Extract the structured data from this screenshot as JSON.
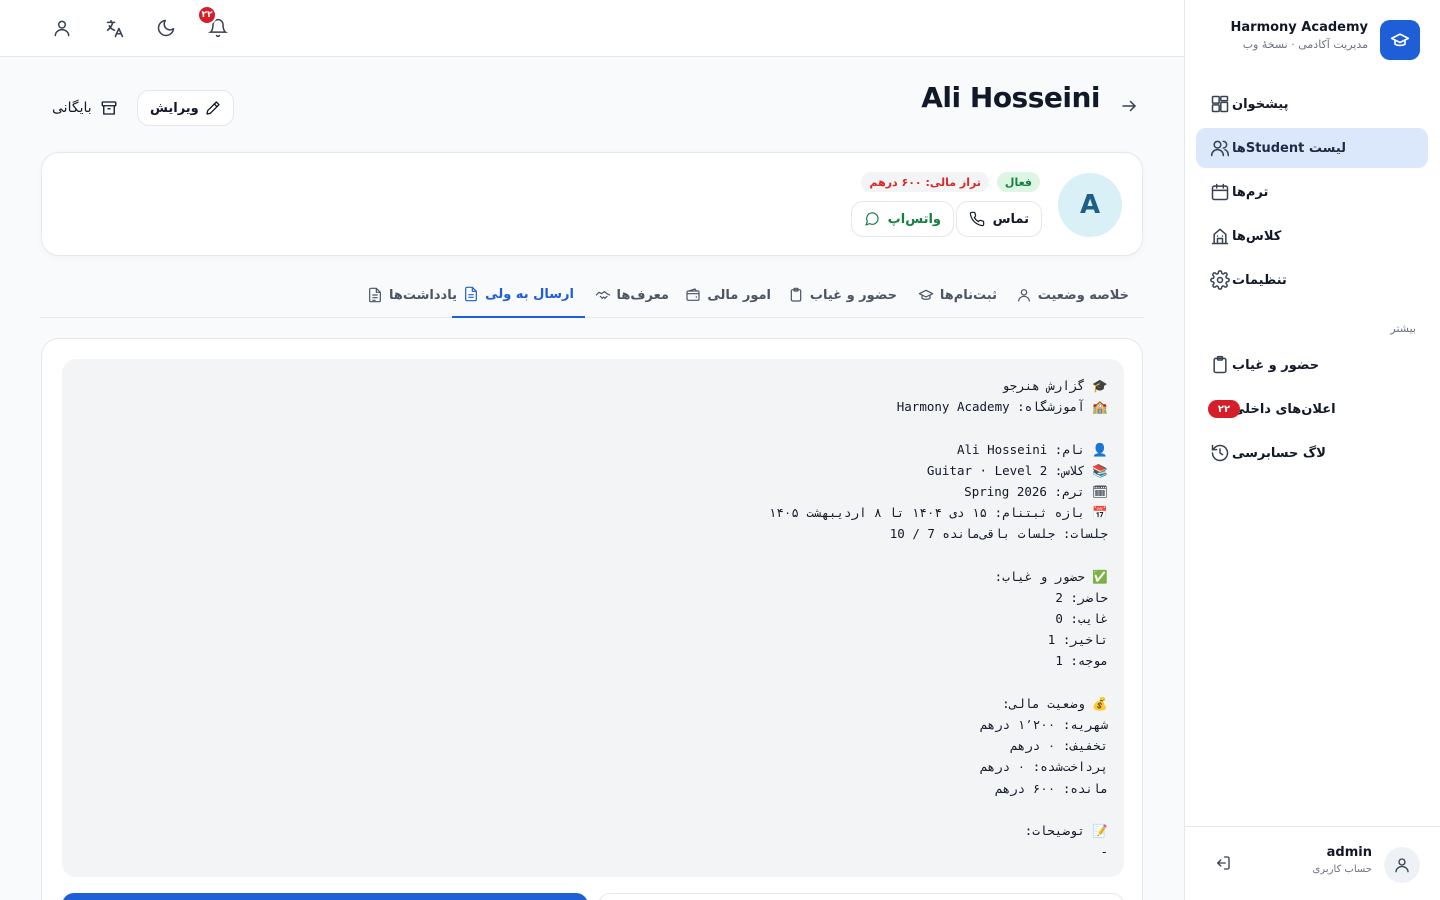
{
  "brand": {
    "title": "Harmony Academy",
    "subtitle": "مدیریت آکادمی · نسخهٔ وب"
  },
  "sidebar": {
    "items": [
      {
        "label": "پیشخوان",
        "icon": "dashboard-icon",
        "active": false
      },
      {
        "label": "لیست Studentها",
        "icon": "users-icon",
        "active": true
      },
      {
        "label": "ترم‌ها",
        "icon": "calendar-icon",
        "active": false
      },
      {
        "label": "کلاس‌ها",
        "icon": "building-icon",
        "active": false
      },
      {
        "label": "تنظیمات",
        "icon": "gear-icon",
        "active": false
      }
    ],
    "more_title": "بیشتر",
    "more_items": [
      {
        "label": "حضور و غیاب",
        "icon": "clipboard-icon"
      },
      {
        "label": "اعلان‌های داخلی",
        "icon": "bell-icon",
        "badge": "۲۲"
      },
      {
        "label": "لاگ حسابرسی",
        "icon": "history-icon"
      }
    ]
  },
  "user": {
    "name": "admin",
    "role": "حساب کاربری"
  },
  "topbar": {
    "notification_count": "۲۲"
  },
  "page": {
    "title": "Ali Hosseini",
    "edit_label": "ویرایش",
    "archive_label": "بایگانی"
  },
  "profile": {
    "avatar_letter": "A",
    "status": "فعال",
    "balance": "تراز مالی: ۶۰۰ درهم",
    "call_label": "تماس",
    "whatsapp_label": "واتس‌اپ"
  },
  "tabs": [
    {
      "label": "خلاصه وضعیت",
      "icon": "user-icon"
    },
    {
      "label": "ثبت‌نام‌ها",
      "icon": "graduation-cap-icon"
    },
    {
      "label": "حضور و غیاب",
      "icon": "clipboard-icon"
    },
    {
      "label": "امور مالی",
      "icon": "wallet-icon"
    },
    {
      "label": "معرف‌ها",
      "icon": "handshake-icon"
    },
    {
      "label": "ارسال به ولی",
      "icon": "document-icon",
      "active": true
    },
    {
      "label": "یادداشت‌ها",
      "icon": "notes-icon"
    }
  ],
  "report": {
    "lines": [
      "🎓 گزارش هنرجو",
      "🏫 آموزشگاه: Harmony Academy",
      "",
      "👤 نام: Ali Hosseini",
      "📚 کلاس: Guitar · Level 2",
      "🗓 ترم: Spring 2026",
      "📅 بازه ثبتنام: ۱۵ دی ۱۴۰۴ تا ۸ اردیبهشت ۱۴۰۵",
      "جلسات: جلسات باقی‌مانده 7 / 10",
      "",
      "✅ حضور و غیاب:",
      "حاضر: 2",
      "غایب: 0",
      "تاخیر: 1",
      "موجه: 1",
      "",
      "💰 وضعیت مالی:",
      "شهریه: ۱٬۲۰۰ درهم",
      "تخفیف: ۰ درهم",
      "پرداخت‌شده: ۰ درهم",
      "مانده: ۶۰۰ درهم",
      "",
      "📝 توضیحات:",
      "-"
    ]
  },
  "colors": {
    "primary": "#1e5fd8",
    "active_nav_bg": "#dbe8fc",
    "badge_red": "#d41f2a",
    "success_green": "#15803d",
    "danger_red": "#dc2626"
  }
}
